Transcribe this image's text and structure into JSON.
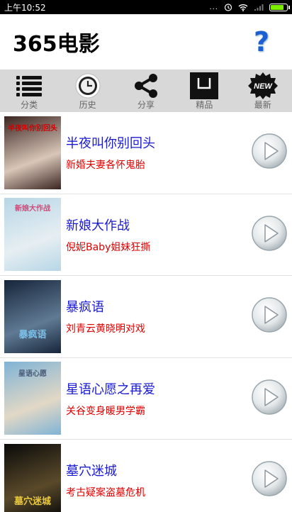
{
  "status": {
    "time": "上午10:52",
    "dots": "...",
    "battery_level": 0.75
  },
  "header": {
    "title": "365电影",
    "help_label": "?"
  },
  "toolbar": [
    {
      "label": "分类",
      "icon": "list-icon"
    },
    {
      "label": "历史",
      "icon": "history-icon"
    },
    {
      "label": "分享",
      "icon": "share-icon"
    },
    {
      "label": "精品",
      "icon": "bag-icon"
    },
    {
      "label": "最新",
      "icon": "new-badge-icon",
      "badge_text": "NEW"
    }
  ],
  "movies": [
    {
      "title": "半夜叫你别回头",
      "subtitle": "新婚夫妻各怀鬼胎",
      "poster_caption": "半夜叫你别回头",
      "poster_colors": [
        "#3a2420",
        "#d8c6b8"
      ]
    },
    {
      "title": "新娘大作战",
      "subtitle": "倪妮Baby姐妹狂撕",
      "poster_caption": "新娘大作战",
      "poster_colors": [
        "#b7d6e6",
        "#e6eef2"
      ]
    },
    {
      "title": "暴疯语",
      "subtitle": "刘青云黄晓明对戏",
      "poster_caption": "暴疯语",
      "poster_colors": [
        "#16253a",
        "#607a94"
      ]
    },
    {
      "title": "星语心愿之再爱",
      "subtitle": "关谷变身暖男学霸",
      "poster_caption": "星语心愿",
      "poster_colors": [
        "#7fb3d6",
        "#e2d8c6"
      ]
    },
    {
      "title": "墓穴迷城",
      "subtitle": "考古疑案盗墓危机",
      "poster_caption": "墓穴迷城",
      "poster_colors": [
        "#0a0a0a",
        "#5a4a2a"
      ]
    }
  ]
}
